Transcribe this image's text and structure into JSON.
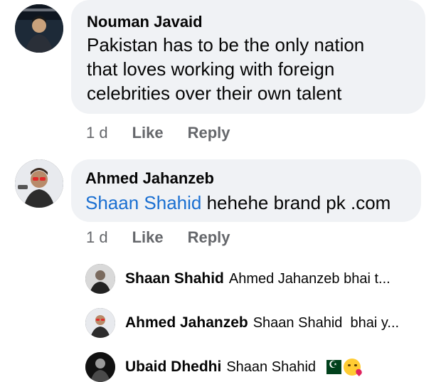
{
  "comments": [
    {
      "author": "Nouman Javaid",
      "text_lines": [
        "Pakistan has to be the only nation",
        "that loves working with foreign",
        "celebrities over their own talent"
      ],
      "time": "1 d",
      "like_label": "Like",
      "reply_label": "Reply",
      "avatar_icon": "profile-photo-icon"
    },
    {
      "author": "Ahmed Jahanzeb",
      "mention": "Shaan Shahid",
      "text": " hehehe brand pk .com",
      "time": "1 d",
      "like_label": "Like",
      "reply_label": "Reply",
      "avatar_icon": "profile-photo-icon"
    }
  ],
  "replies": [
    {
      "author": "Shaan Shahid",
      "preview": "Ahmed Jahanzeb bhai t..."
    },
    {
      "author": "Ahmed Jahanzeb",
      "preview": "Shaan Shahid  bhai y..."
    },
    {
      "author": "Ubaid Dhedhi",
      "preview": "Shaan Shahid",
      "emoji_icons": [
        "pakistan-flag-icon",
        "face-blowing-kiss-icon"
      ]
    }
  ],
  "colors": {
    "bubble": "#f0f2f5",
    "mention": "#1a6fd1",
    "meta": "#65676b",
    "text": "#050505"
  }
}
